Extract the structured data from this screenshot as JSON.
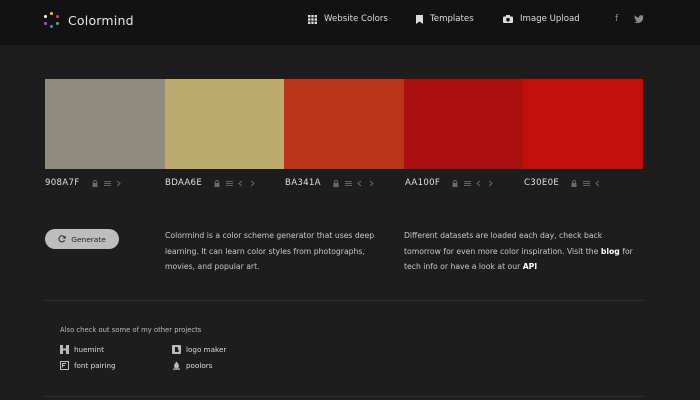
{
  "brand": {
    "name": "Colormind"
  },
  "nav": {
    "website_colors": "Website Colors",
    "templates": "Templates",
    "image_upload": "Image Upload",
    "social_facebook": "f",
    "social_twitter": "t"
  },
  "palette": [
    {
      "hex": "908A7F",
      "color": "#908A7F"
    },
    {
      "hex": "BDAA6E",
      "color": "#BDAA6E"
    },
    {
      "hex": "BA341A",
      "color": "#BA341A"
    },
    {
      "hex": "AA100F",
      "color": "#AA100F"
    },
    {
      "hex": "C30E0E",
      "color": "#C30E0E"
    }
  ],
  "generate_button": {
    "label": "Generate"
  },
  "description_left": {
    "text": "Colormind is a color scheme generator that uses deep learning. It can learn color styles from photographs, movies, and popular art."
  },
  "description_right": {
    "text_1": "Different datasets are loaded each day, check back tomorrow for even more color inspiration. Visit the",
    "blog_link": "blog",
    "text_2": "for tech info or have a look at our",
    "api_link": "API"
  },
  "projects": {
    "heading": "Also check out some of my other projects",
    "items": [
      {
        "label": "huemint",
        "icon": "huemint-icon"
      },
      {
        "label": "logo maker",
        "icon": "logo-maker-icon"
      },
      {
        "label": "font pairing",
        "icon": "font-pairing-icon"
      },
      {
        "label": "poolors",
        "icon": "poolors-icon"
      }
    ]
  },
  "colors": {
    "topbar": "#121212",
    "background": "#1d1d1d",
    "button_bg": "#bdbdbd"
  }
}
